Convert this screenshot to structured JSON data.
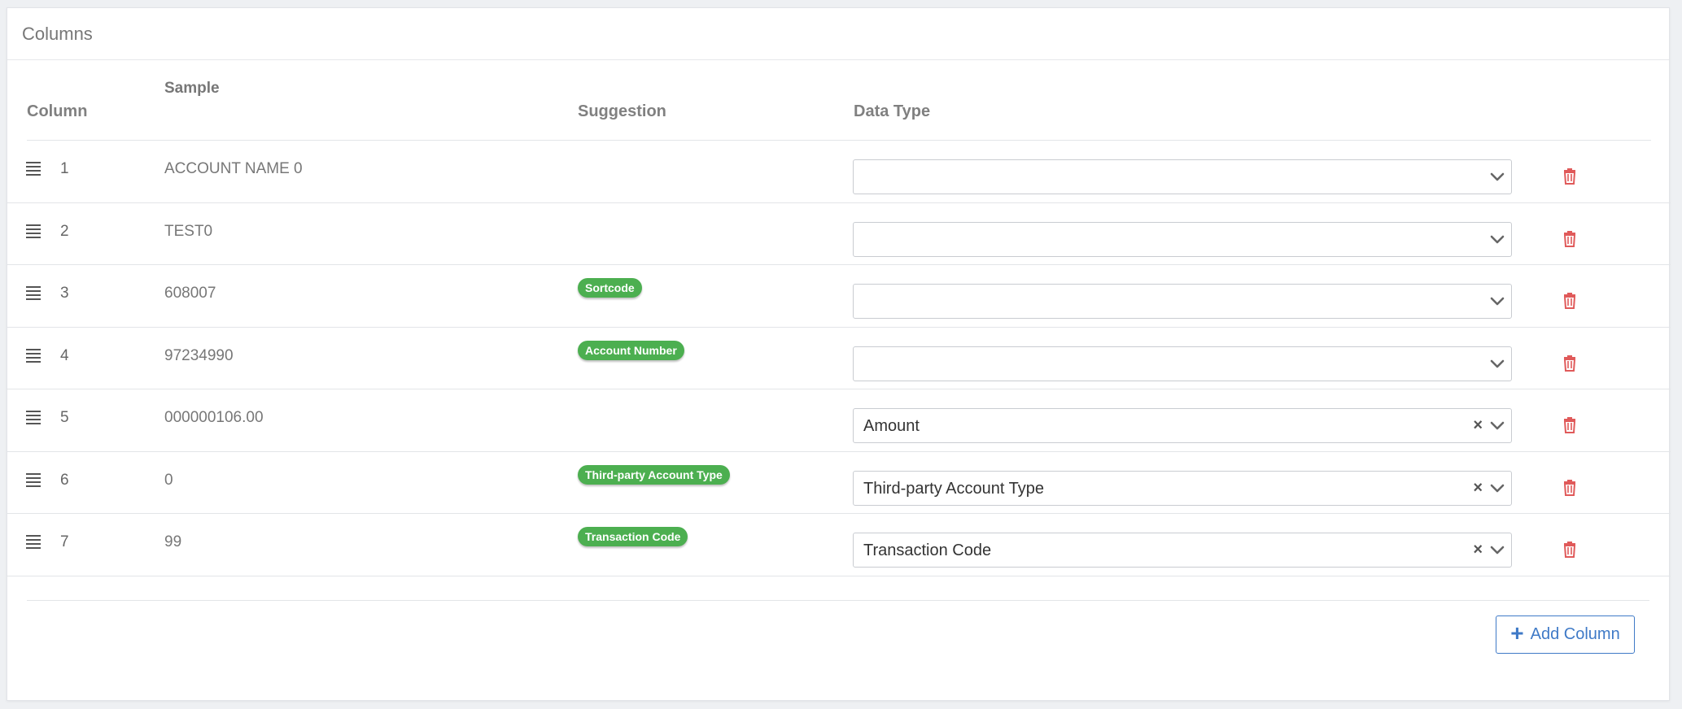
{
  "panel": {
    "title": "Columns"
  },
  "table": {
    "headers": {
      "column": "Column",
      "sample": "Sample",
      "suggestion": "Suggestion",
      "data_type": "Data Type"
    },
    "rows": [
      {
        "num": "1",
        "sample": "ACCOUNT NAME 0",
        "suggestion": "",
        "data_type": ""
      },
      {
        "num": "2",
        "sample": "TEST0",
        "suggestion": "",
        "data_type": ""
      },
      {
        "num": "3",
        "sample": "608007",
        "suggestion": "Sortcode",
        "data_type": ""
      },
      {
        "num": "4",
        "sample": "97234990",
        "suggestion": "Account Number",
        "data_type": ""
      },
      {
        "num": "5",
        "sample": "000000106.00",
        "suggestion": "",
        "data_type": "Amount"
      },
      {
        "num": "6",
        "sample": "0",
        "suggestion": "Third-party Account Type",
        "data_type": "Third-party Account Type"
      },
      {
        "num": "7",
        "sample": "99",
        "suggestion": "Transaction Code",
        "data_type": "Transaction Code"
      }
    ]
  },
  "actions": {
    "add_column": "Add Column"
  },
  "colors": {
    "accent": "#3f7ac7",
    "badge": "#4caf50",
    "delete": "#e05a5a"
  },
  "icons": {
    "drag": "drag-handle-icon",
    "delete": "trash-icon",
    "dropdown": "chevron-down-icon",
    "clear": "clear-x-icon",
    "add": "plus-icon"
  }
}
